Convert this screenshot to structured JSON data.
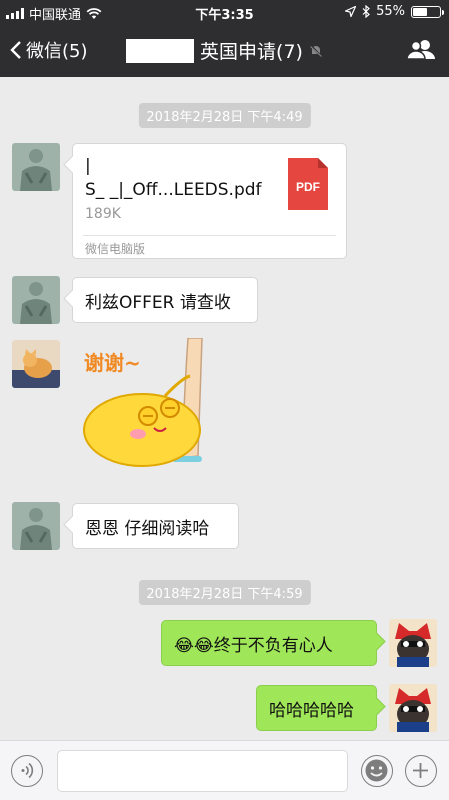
{
  "status_bar": {
    "carrier": "中国联通",
    "time": "下午3:35",
    "battery": "55%",
    "battery_level": 0.55
  },
  "nav": {
    "back_label": "微信(5)",
    "chat_title": "英国申请(7)"
  },
  "messages": {
    "timestamp_1": "2018年2月28日 下午4:49",
    "file": {
      "name_line1": "|",
      "name_line2": "S_ _|_Off...LEEDS.pdf",
      "size": "189K",
      "source": "微信电脑版",
      "type_label": "PDF"
    },
    "msg_offer": "利兹OFFER 请查收",
    "sticker_text": "谢谢~",
    "msg_read": "恩恩 仔细阅读哈",
    "timestamp_2": "2018年2月28日 下午4:59",
    "msg_heart": "😂😂终于不负有心人",
    "msg_haha": "哈哈哈哈哈"
  },
  "input": {
    "placeholder": ""
  },
  "colors": {
    "nav_bg": "#2e2e31",
    "chat_bg": "#ebebeb",
    "sent_bubble": "#9fe658",
    "pdf_red": "#e5463f"
  }
}
